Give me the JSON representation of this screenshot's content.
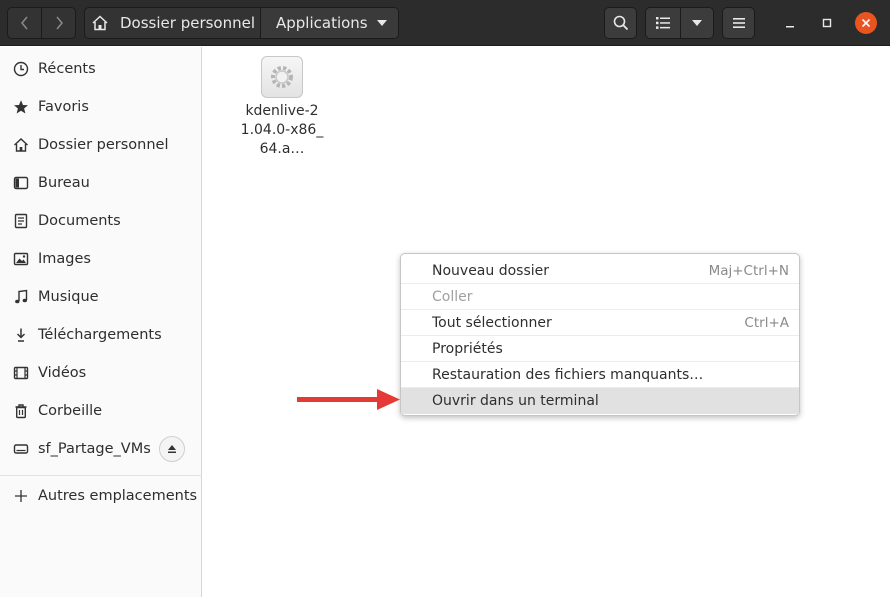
{
  "header": {
    "path": {
      "home_label": "Dossier personnel",
      "current_label": "Applications"
    },
    "icons": {
      "back": "chevron-left-icon",
      "forward": "chevron-right-icon",
      "home": "home-icon",
      "path_menu": "triangle-down-icon",
      "search": "search-icon",
      "view_list": "list-view-icon",
      "view_options": "triangle-down-icon",
      "menu": "hamburger-icon",
      "minimize": "minimize-icon",
      "maximize": "maximize-icon",
      "close": "close-icon"
    },
    "close_color": "#e95420"
  },
  "sidebar": {
    "items": [
      {
        "label": "Récents",
        "icon": "clock-icon"
      },
      {
        "label": "Favoris",
        "icon": "star-icon"
      },
      {
        "label": "Dossier personnel",
        "icon": "home-icon"
      },
      {
        "label": "Bureau",
        "icon": "desktop-icon"
      },
      {
        "label": "Documents",
        "icon": "document-icon"
      },
      {
        "label": "Images",
        "icon": "image-icon"
      },
      {
        "label": "Musique",
        "icon": "music-icon"
      },
      {
        "label": "Téléchargements",
        "icon": "download-icon"
      },
      {
        "label": "Vidéos",
        "icon": "video-icon"
      },
      {
        "label": "Corbeille",
        "icon": "trash-icon"
      },
      {
        "label": "sf_Partage_VMs",
        "icon": "drive-icon"
      }
    ],
    "other_locations": {
      "label": "Autres emplacements",
      "icon": "plus-icon"
    },
    "eject_icon": "eject-icon"
  },
  "files": [
    {
      "name": "kdenlive-21.04.0-x86_64.a…",
      "icon": "gear-icon"
    }
  ],
  "context_menu": {
    "items": [
      {
        "label": "Nouveau dossier",
        "accel": "Maj+Ctrl+N",
        "disabled": false
      },
      {
        "label": "Coller",
        "accel": "",
        "disabled": true
      },
      {
        "label": "Tout sélectionner",
        "accel": "Ctrl+A",
        "disabled": false
      },
      {
        "label": "Propriétés",
        "accel": "",
        "disabled": false
      },
      {
        "label": "Restauration des fichiers manquants…",
        "accel": "",
        "disabled": false
      },
      {
        "label": "Ouvrir dans un terminal",
        "accel": "",
        "disabled": false,
        "highlighted": true
      }
    ]
  },
  "annotation": {
    "arrow_color": "#e53935",
    "arrow_icon": "arrow-right-icon"
  }
}
